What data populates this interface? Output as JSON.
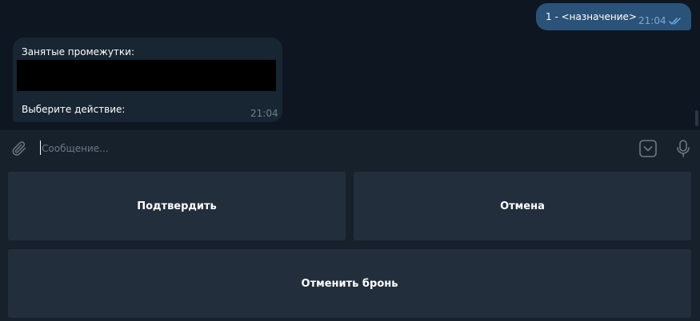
{
  "chat": {
    "outgoing": {
      "text": "1 - <назначение>",
      "time": "21:04",
      "status_icon": "double-check-icon"
    },
    "incoming": {
      "line1": "Занятые промежутки:",
      "line2": "Выберите действие:",
      "time": "21:04"
    }
  },
  "composer": {
    "placeholder": "Сообщение...",
    "value": "",
    "attach_icon": "paperclip-icon",
    "keyboard_icon": "bot-keyboard-icon",
    "mic_icon": "microphone-icon"
  },
  "keyboard": {
    "confirm_label": "Подтвердить",
    "cancel_label": "Отмена",
    "unbook_label": "Отменить бронь"
  },
  "colors": {
    "background": "#0e1621",
    "panel": "#17212b",
    "outgoing_bubble": "#2b5278",
    "incoming_bubble": "#182533",
    "button": "#232e3c",
    "accent": "#5288c1"
  }
}
